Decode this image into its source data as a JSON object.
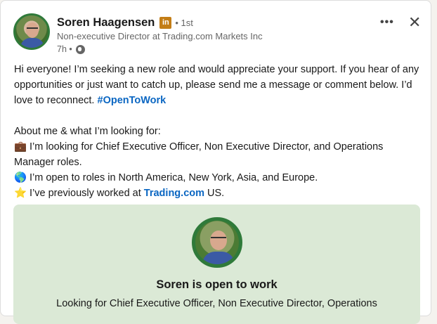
{
  "post": {
    "author": {
      "name": "Soren Haagensen",
      "badge": "in",
      "degree": "• 1st",
      "headline": "Non-executive Director at Trading.com Markets Inc",
      "time": "7h •"
    },
    "actions": {
      "more": "•••",
      "close": "✕"
    },
    "body": {
      "intro": "Hi everyone! I’m seeking a new role and would appreciate your support. If you hear of any opportunities or just want to catch up, please send me a message or comment below. I’d love to reconnect. ",
      "hashtag": "#OpenToWork",
      "about_heading": "About me & what I’m looking for:",
      "bullet1_icon": "💼",
      "bullet1": "I’m looking for Chief Executive Officer, Non Executive Director, and Operations Manager roles.",
      "bullet2_icon": "🌎",
      "bullet2": "I’m open to roles in North America, New York, Asia, and Europe.",
      "bullet3_icon": "⭐",
      "bullet3_prefix": "I’ve previously worked at ",
      "bullet3_link": "Trading.com",
      "bullet3_suffix": " US."
    },
    "open_to_work": {
      "title": "Soren is open to work",
      "description": "Looking for Chief Executive Officer, Non Executive Director, Operations"
    }
  }
}
